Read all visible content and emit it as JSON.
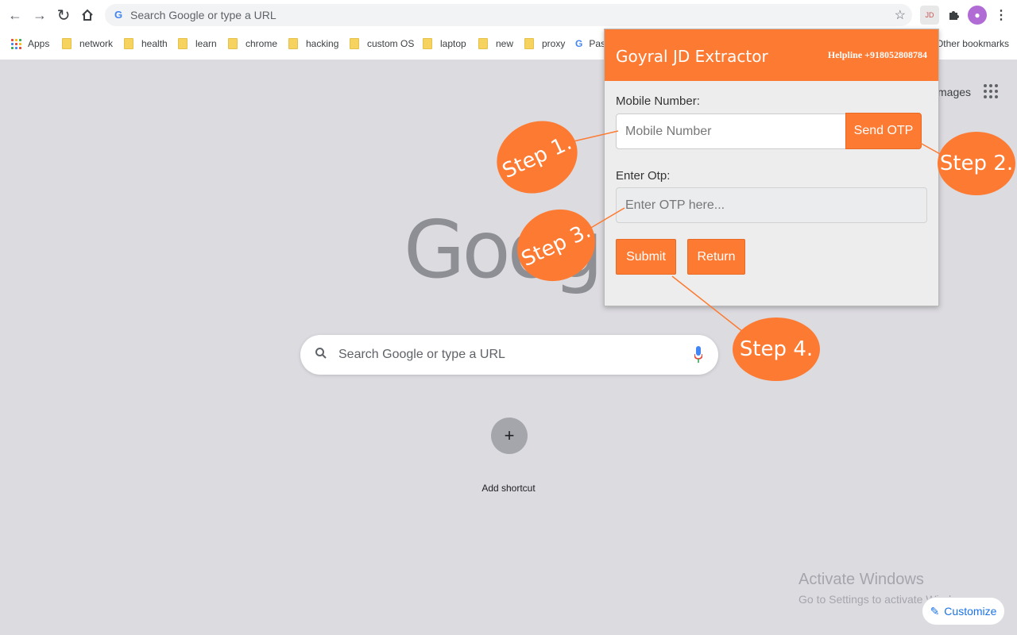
{
  "browser": {
    "omnibox_placeholder": "Search Google or type a URL",
    "bookmarks": [
      {
        "label": "Apps",
        "type": "apps"
      },
      {
        "label": "network",
        "type": "folder"
      },
      {
        "label": "health",
        "type": "folder"
      },
      {
        "label": "learn",
        "type": "folder"
      },
      {
        "label": "chrome",
        "type": "folder"
      },
      {
        "label": "hacking",
        "type": "folder"
      },
      {
        "label": "custom OS",
        "type": "folder"
      },
      {
        "label": "laptop",
        "type": "folder"
      },
      {
        "label": "new",
        "type": "folder"
      },
      {
        "label": "proxy",
        "type": "folder"
      },
      {
        "label": "Pas",
        "type": "google"
      }
    ],
    "other_bookmarks": "Other bookmarks"
  },
  "ntp": {
    "images_link": "mages",
    "logo_text": "Google",
    "search_placeholder": "Search Google or type a URL",
    "add_shortcut_symbol": "+",
    "add_shortcut_label": "Add shortcut",
    "customize_label": "Customize",
    "watermark_title": "Activate Windows",
    "watermark_subtitle": "Go to Settings to activate Windows."
  },
  "popup": {
    "title": "Goyral JD Extractor",
    "helpline": "Helpline +918052808784",
    "mobile_label": "Mobile Number:",
    "mobile_placeholder": "Mobile Number",
    "send_otp_label": "Send OTP",
    "otp_label": "Enter Otp:",
    "otp_placeholder": "Enter OTP here...",
    "submit_label": "Submit",
    "return_label": "Return"
  },
  "annotations": {
    "step1": "Step 1.",
    "step2": "Step 2.",
    "step3": "Step 3.",
    "step4": "Step 4."
  },
  "colors": {
    "accent": "#fd7a32",
    "page_bg": "#dcdbe0"
  },
  "icons": [
    "back-icon",
    "forward-icon",
    "reload-icon",
    "home-icon",
    "google-g-icon",
    "star-icon",
    "extension-jd-icon",
    "puzzle-icon",
    "profile-avatar-icon",
    "kebab-menu-icon",
    "apps-grid-icon",
    "folder-icon",
    "search-icon",
    "mic-icon",
    "pencil-icon"
  ]
}
